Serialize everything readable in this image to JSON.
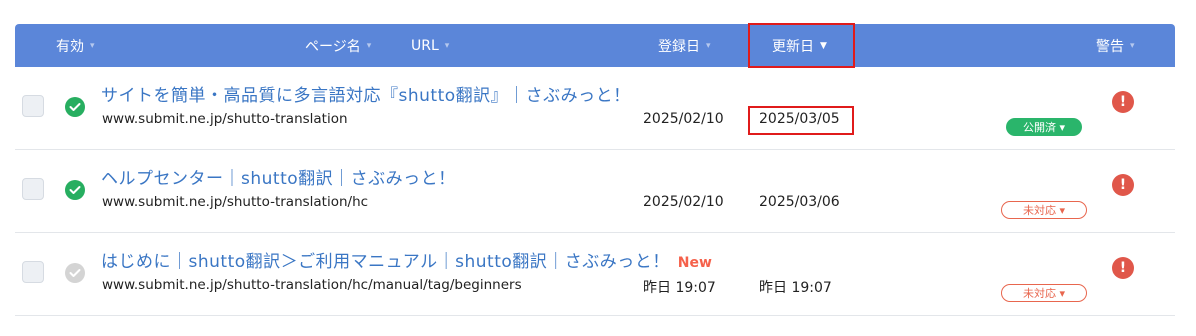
{
  "header": {
    "enabled": "有効",
    "page_name": "ページ名",
    "url": "URL",
    "registered": "登録日",
    "updated": "更新日",
    "warning": "警告",
    "sort_inactive_icon": "▾",
    "sort_active_icon": "▼"
  },
  "rows": [
    {
      "title": "サイトを簡単・高品質に多言語対応『shutto翻訳』｜さぶみっと！",
      "new_label": "",
      "url": "www.submit.ne.jp/shutto-translation",
      "registered": "2025/02/10",
      "updated": "2025/03/05",
      "status_badge": "公開済 ▾",
      "warn_icon": "!"
    },
    {
      "title": "ヘルプセンター｜shutto翻訳｜さぶみっと！",
      "new_label": "",
      "url": "www.submit.ne.jp/shutto-translation/hc",
      "registered": "2025/02/10",
      "updated": "2025/03/06",
      "status_badge": "未対応 ▾",
      "warn_icon": "!"
    },
    {
      "title": "はじめに｜shutto翻訳＞ご利用マニュアル｜shutto翻訳｜さぶみっと！",
      "new_label": "New",
      "url": "www.submit.ne.jp/shutto-translation/hc/manual/tag/beginners",
      "registered": "昨日 19:07",
      "updated": "昨日 19:07",
      "status_badge": "未対応 ▾",
      "warn_icon": "!"
    }
  ],
  "colors": {
    "header_bg": "#5b86d9",
    "link": "#3a76c4",
    "published": "#2ab56b",
    "unpublished": "#e8664e",
    "warning": "#e0574a",
    "highlight": "#e01b1b"
  }
}
